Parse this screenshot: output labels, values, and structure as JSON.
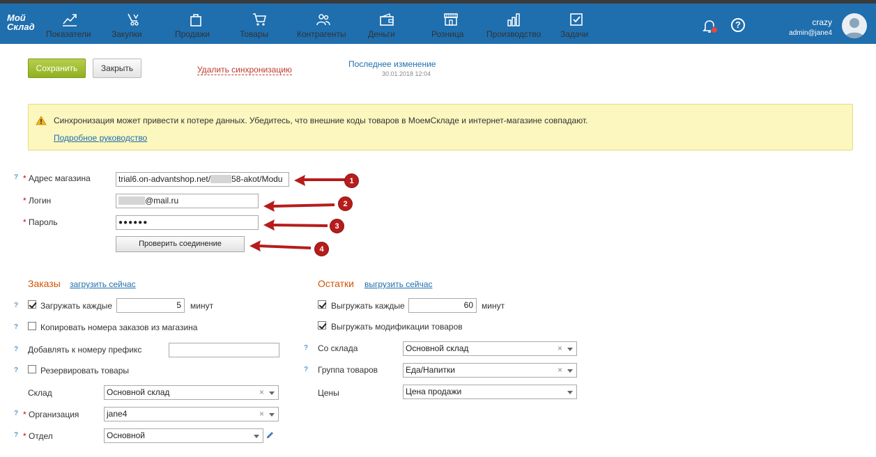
{
  "nav": {
    "logo_line1": "Мой",
    "logo_line2": "Склад",
    "items": [
      {
        "label": "Показатели",
        "icon": "chart-icon"
      },
      {
        "label": "Закупки",
        "icon": "purchase-icon"
      },
      {
        "label": "Продажи",
        "icon": "bag-icon"
      },
      {
        "label": "Товары",
        "icon": "cart-icon"
      },
      {
        "label": "Контрагенты",
        "icon": "people-icon"
      },
      {
        "label": "Деньги",
        "icon": "wallet-icon"
      },
      {
        "label": "Розница",
        "icon": "store-icon"
      },
      {
        "label": "Производство",
        "icon": "factory-icon"
      },
      {
        "label": "Задачи",
        "icon": "task-icon"
      }
    ],
    "help_label": "?",
    "user_name": "crazy",
    "user_login": "admin@jane4"
  },
  "actions": {
    "save_label": "Сохранить",
    "close_label": "Закрыть",
    "delete_sync_label": "Удалить синхронизацию",
    "last_change_label": "Последнее изменение",
    "last_change_date": "30.01.2018 12:04"
  },
  "warning": {
    "text": "Синхронизация может привести к потере данных. Убедитесь, что внешние коды товаров в МоемСкладе и интернет-магазине совпадают.",
    "link": "Подробное руководство"
  },
  "form": {
    "required_mark": "*",
    "help_mark": "?",
    "shop_address_label": "Адрес магазина",
    "shop_address_prefix": "trial6.on-advantshop.net/",
    "shop_address_suffix": "58-akot/Modu",
    "login_label": "Логин",
    "login_suffix": "@mail.ru",
    "password_label": "Пароль",
    "password_value": "●●●●●●",
    "check_button": "Проверить соединение"
  },
  "annotations": [
    "1",
    "2",
    "3",
    "4"
  ],
  "orders": {
    "title": "Заказы",
    "load_now": "загрузить сейчас",
    "load_every_label": "Загружать каждые",
    "load_every_value": "5",
    "minutes": "минут",
    "copy_numbers_label": "Копировать номера заказов из магазина",
    "prefix_label": "Добавлять к номеру префикс",
    "reserve_label": "Резервировать товары",
    "warehouse_label": "Склад",
    "warehouse_value": "Основной склад",
    "organization_label": "Организация",
    "organization_value": "jane4",
    "department_label": "Отдел",
    "department_value": "Основной",
    "clear_mark": "×"
  },
  "stock": {
    "title": "Остатки",
    "export_now": "выгрузить сейчас",
    "export_every_label": "Выгружать каждые",
    "export_every_value": "60",
    "minutes": "минут",
    "export_mods_label": "Выгружать модификации товаров",
    "from_warehouse_label": "Со склада",
    "from_warehouse_value": "Основной склад",
    "product_group_label": "Группа товаров",
    "product_group_value": "Еда/Напитки",
    "prices_label": "Цены",
    "prices_value": "Цена продажи"
  }
}
